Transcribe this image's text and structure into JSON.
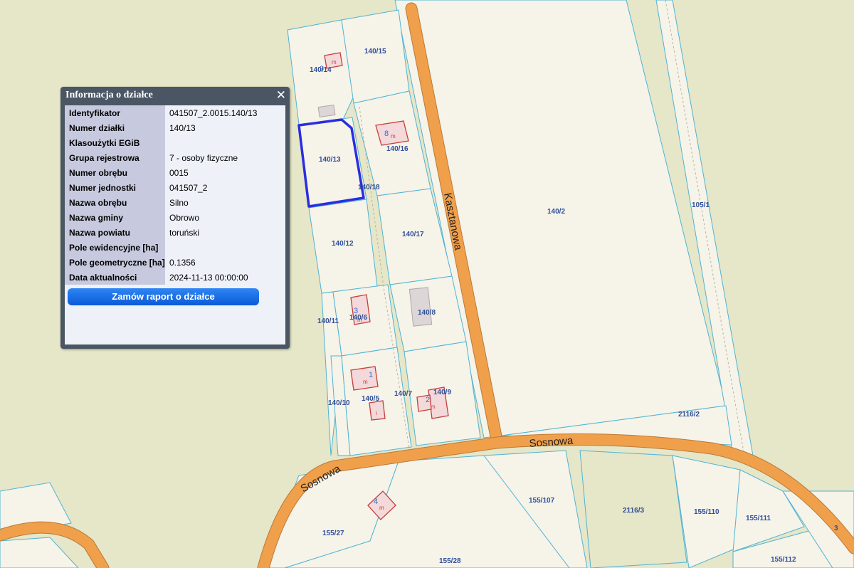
{
  "panel": {
    "title": "Informacja o działce",
    "close_glyph": "✕",
    "rows": [
      {
        "key": "Identyfikator",
        "value": "041507_2.0015.140/13"
      },
      {
        "key": "Numer działki",
        "value": "140/13"
      },
      {
        "key": "Klasoużytki EGiB",
        "value": ""
      },
      {
        "key": "Grupa rejestrowa",
        "value": "7 - osoby fizyczne"
      },
      {
        "key": "Numer obrębu",
        "value": "0015"
      },
      {
        "key": "Numer jednostki",
        "value": "041507_2"
      },
      {
        "key": "Nazwa obrębu",
        "value": "Silno"
      },
      {
        "key": "Nazwa gminy",
        "value": "Obrowo"
      },
      {
        "key": "Nazwa powiatu",
        "value": "toruński"
      },
      {
        "key": "Pole ewidencyjne [ha]",
        "value": ""
      },
      {
        "key": "Pole geometryczne [ha]",
        "value": "0.1356"
      },
      {
        "key": "Data aktualności",
        "value": "2024-11-13 00:00:00"
      }
    ],
    "order_button": "Zamów raport o działce"
  },
  "map": {
    "roads": {
      "kasztanowa": "Kasztanowa",
      "sosnowa_east": "Sosnowa",
      "sosnowa_west": "Sosnowa"
    },
    "parcels": {
      "p140_14": "140/14",
      "p140_15": "140/15",
      "p140_13": "140/13",
      "p140_16": "140/16",
      "p140_18": "140/18",
      "p140_12": "140/12",
      "p140_17": "140/17",
      "p140_2": "140/2",
      "p105_1": "105/1",
      "p140_11": "140/11",
      "p140_6": "140/6",
      "p140_8": "140/8",
      "p140_10": "140/10",
      "p140_5": "140/5",
      "p140_7": "140/7",
      "p140_9": "140/9",
      "p2116_2": "2116/2",
      "p155_107": "155/107",
      "p2116_3": "2116/3",
      "p155_110": "155/110",
      "p155_111": "155/111",
      "p155_27": "155/27",
      "p155_28": "155/28",
      "p155_112": "155/112",
      "p_edge3": "3"
    },
    "buildings": {
      "b9": "9",
      "b8": "8",
      "b3": "3",
      "b1": "1",
      "b2": "2",
      "b4": "4",
      "m": "m",
      "i": "i"
    },
    "colors": {
      "background": "#e6e6c8",
      "parcel_fill": "#f6f3e9",
      "parcel_border": "#4fb4d4",
      "road": "#f0a04b",
      "selection": "#2a2ee0"
    }
  }
}
